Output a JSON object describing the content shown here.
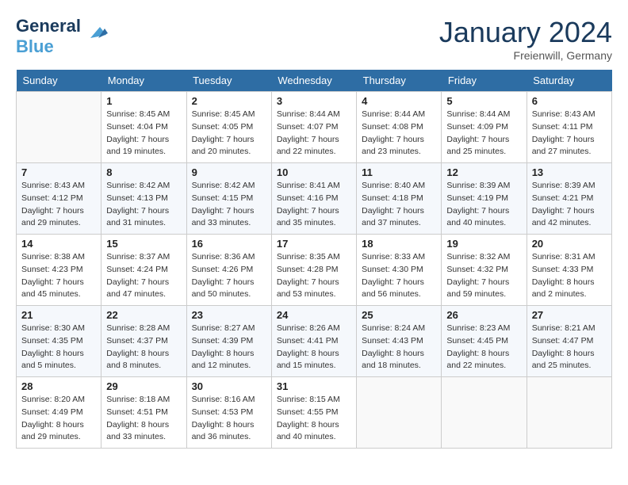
{
  "header": {
    "logo_line1": "General",
    "logo_line2": "Blue",
    "month": "January 2024",
    "location": "Freienwill, Germany"
  },
  "days_of_week": [
    "Sunday",
    "Monday",
    "Tuesday",
    "Wednesday",
    "Thursday",
    "Friday",
    "Saturday"
  ],
  "weeks": [
    [
      {
        "day": "",
        "sunrise": "",
        "sunset": "",
        "daylight": ""
      },
      {
        "day": "1",
        "sunrise": "Sunrise: 8:45 AM",
        "sunset": "Sunset: 4:04 PM",
        "daylight": "Daylight: 7 hours and 19 minutes."
      },
      {
        "day": "2",
        "sunrise": "Sunrise: 8:45 AM",
        "sunset": "Sunset: 4:05 PM",
        "daylight": "Daylight: 7 hours and 20 minutes."
      },
      {
        "day": "3",
        "sunrise": "Sunrise: 8:44 AM",
        "sunset": "Sunset: 4:07 PM",
        "daylight": "Daylight: 7 hours and 22 minutes."
      },
      {
        "day": "4",
        "sunrise": "Sunrise: 8:44 AM",
        "sunset": "Sunset: 4:08 PM",
        "daylight": "Daylight: 7 hours and 23 minutes."
      },
      {
        "day": "5",
        "sunrise": "Sunrise: 8:44 AM",
        "sunset": "Sunset: 4:09 PM",
        "daylight": "Daylight: 7 hours and 25 minutes."
      },
      {
        "day": "6",
        "sunrise": "Sunrise: 8:43 AM",
        "sunset": "Sunset: 4:11 PM",
        "daylight": "Daylight: 7 hours and 27 minutes."
      }
    ],
    [
      {
        "day": "7",
        "sunrise": "Sunrise: 8:43 AM",
        "sunset": "Sunset: 4:12 PM",
        "daylight": "Daylight: 7 hours and 29 minutes."
      },
      {
        "day": "8",
        "sunrise": "Sunrise: 8:42 AM",
        "sunset": "Sunset: 4:13 PM",
        "daylight": "Daylight: 7 hours and 31 minutes."
      },
      {
        "day": "9",
        "sunrise": "Sunrise: 8:42 AM",
        "sunset": "Sunset: 4:15 PM",
        "daylight": "Daylight: 7 hours and 33 minutes."
      },
      {
        "day": "10",
        "sunrise": "Sunrise: 8:41 AM",
        "sunset": "Sunset: 4:16 PM",
        "daylight": "Daylight: 7 hours and 35 minutes."
      },
      {
        "day": "11",
        "sunrise": "Sunrise: 8:40 AM",
        "sunset": "Sunset: 4:18 PM",
        "daylight": "Daylight: 7 hours and 37 minutes."
      },
      {
        "day": "12",
        "sunrise": "Sunrise: 8:39 AM",
        "sunset": "Sunset: 4:19 PM",
        "daylight": "Daylight: 7 hours and 40 minutes."
      },
      {
        "day": "13",
        "sunrise": "Sunrise: 8:39 AM",
        "sunset": "Sunset: 4:21 PM",
        "daylight": "Daylight: 7 hours and 42 minutes."
      }
    ],
    [
      {
        "day": "14",
        "sunrise": "Sunrise: 8:38 AM",
        "sunset": "Sunset: 4:23 PM",
        "daylight": "Daylight: 7 hours and 45 minutes."
      },
      {
        "day": "15",
        "sunrise": "Sunrise: 8:37 AM",
        "sunset": "Sunset: 4:24 PM",
        "daylight": "Daylight: 7 hours and 47 minutes."
      },
      {
        "day": "16",
        "sunrise": "Sunrise: 8:36 AM",
        "sunset": "Sunset: 4:26 PM",
        "daylight": "Daylight: 7 hours and 50 minutes."
      },
      {
        "day": "17",
        "sunrise": "Sunrise: 8:35 AM",
        "sunset": "Sunset: 4:28 PM",
        "daylight": "Daylight: 7 hours and 53 minutes."
      },
      {
        "day": "18",
        "sunrise": "Sunrise: 8:33 AM",
        "sunset": "Sunset: 4:30 PM",
        "daylight": "Daylight: 7 hours and 56 minutes."
      },
      {
        "day": "19",
        "sunrise": "Sunrise: 8:32 AM",
        "sunset": "Sunset: 4:32 PM",
        "daylight": "Daylight: 7 hours and 59 minutes."
      },
      {
        "day": "20",
        "sunrise": "Sunrise: 8:31 AM",
        "sunset": "Sunset: 4:33 PM",
        "daylight": "Daylight: 8 hours and 2 minutes."
      }
    ],
    [
      {
        "day": "21",
        "sunrise": "Sunrise: 8:30 AM",
        "sunset": "Sunset: 4:35 PM",
        "daylight": "Daylight: 8 hours and 5 minutes."
      },
      {
        "day": "22",
        "sunrise": "Sunrise: 8:28 AM",
        "sunset": "Sunset: 4:37 PM",
        "daylight": "Daylight: 8 hours and 8 minutes."
      },
      {
        "day": "23",
        "sunrise": "Sunrise: 8:27 AM",
        "sunset": "Sunset: 4:39 PM",
        "daylight": "Daylight: 8 hours and 12 minutes."
      },
      {
        "day": "24",
        "sunrise": "Sunrise: 8:26 AM",
        "sunset": "Sunset: 4:41 PM",
        "daylight": "Daylight: 8 hours and 15 minutes."
      },
      {
        "day": "25",
        "sunrise": "Sunrise: 8:24 AM",
        "sunset": "Sunset: 4:43 PM",
        "daylight": "Daylight: 8 hours and 18 minutes."
      },
      {
        "day": "26",
        "sunrise": "Sunrise: 8:23 AM",
        "sunset": "Sunset: 4:45 PM",
        "daylight": "Daylight: 8 hours and 22 minutes."
      },
      {
        "day": "27",
        "sunrise": "Sunrise: 8:21 AM",
        "sunset": "Sunset: 4:47 PM",
        "daylight": "Daylight: 8 hours and 25 minutes."
      }
    ],
    [
      {
        "day": "28",
        "sunrise": "Sunrise: 8:20 AM",
        "sunset": "Sunset: 4:49 PM",
        "daylight": "Daylight: 8 hours and 29 minutes."
      },
      {
        "day": "29",
        "sunrise": "Sunrise: 8:18 AM",
        "sunset": "Sunset: 4:51 PM",
        "daylight": "Daylight: 8 hours and 33 minutes."
      },
      {
        "day": "30",
        "sunrise": "Sunrise: 8:16 AM",
        "sunset": "Sunset: 4:53 PM",
        "daylight": "Daylight: 8 hours and 36 minutes."
      },
      {
        "day": "31",
        "sunrise": "Sunrise: 8:15 AM",
        "sunset": "Sunset: 4:55 PM",
        "daylight": "Daylight: 8 hours and 40 minutes."
      },
      {
        "day": "",
        "sunrise": "",
        "sunset": "",
        "daylight": ""
      },
      {
        "day": "",
        "sunrise": "",
        "sunset": "",
        "daylight": ""
      },
      {
        "day": "",
        "sunrise": "",
        "sunset": "",
        "daylight": ""
      }
    ]
  ]
}
